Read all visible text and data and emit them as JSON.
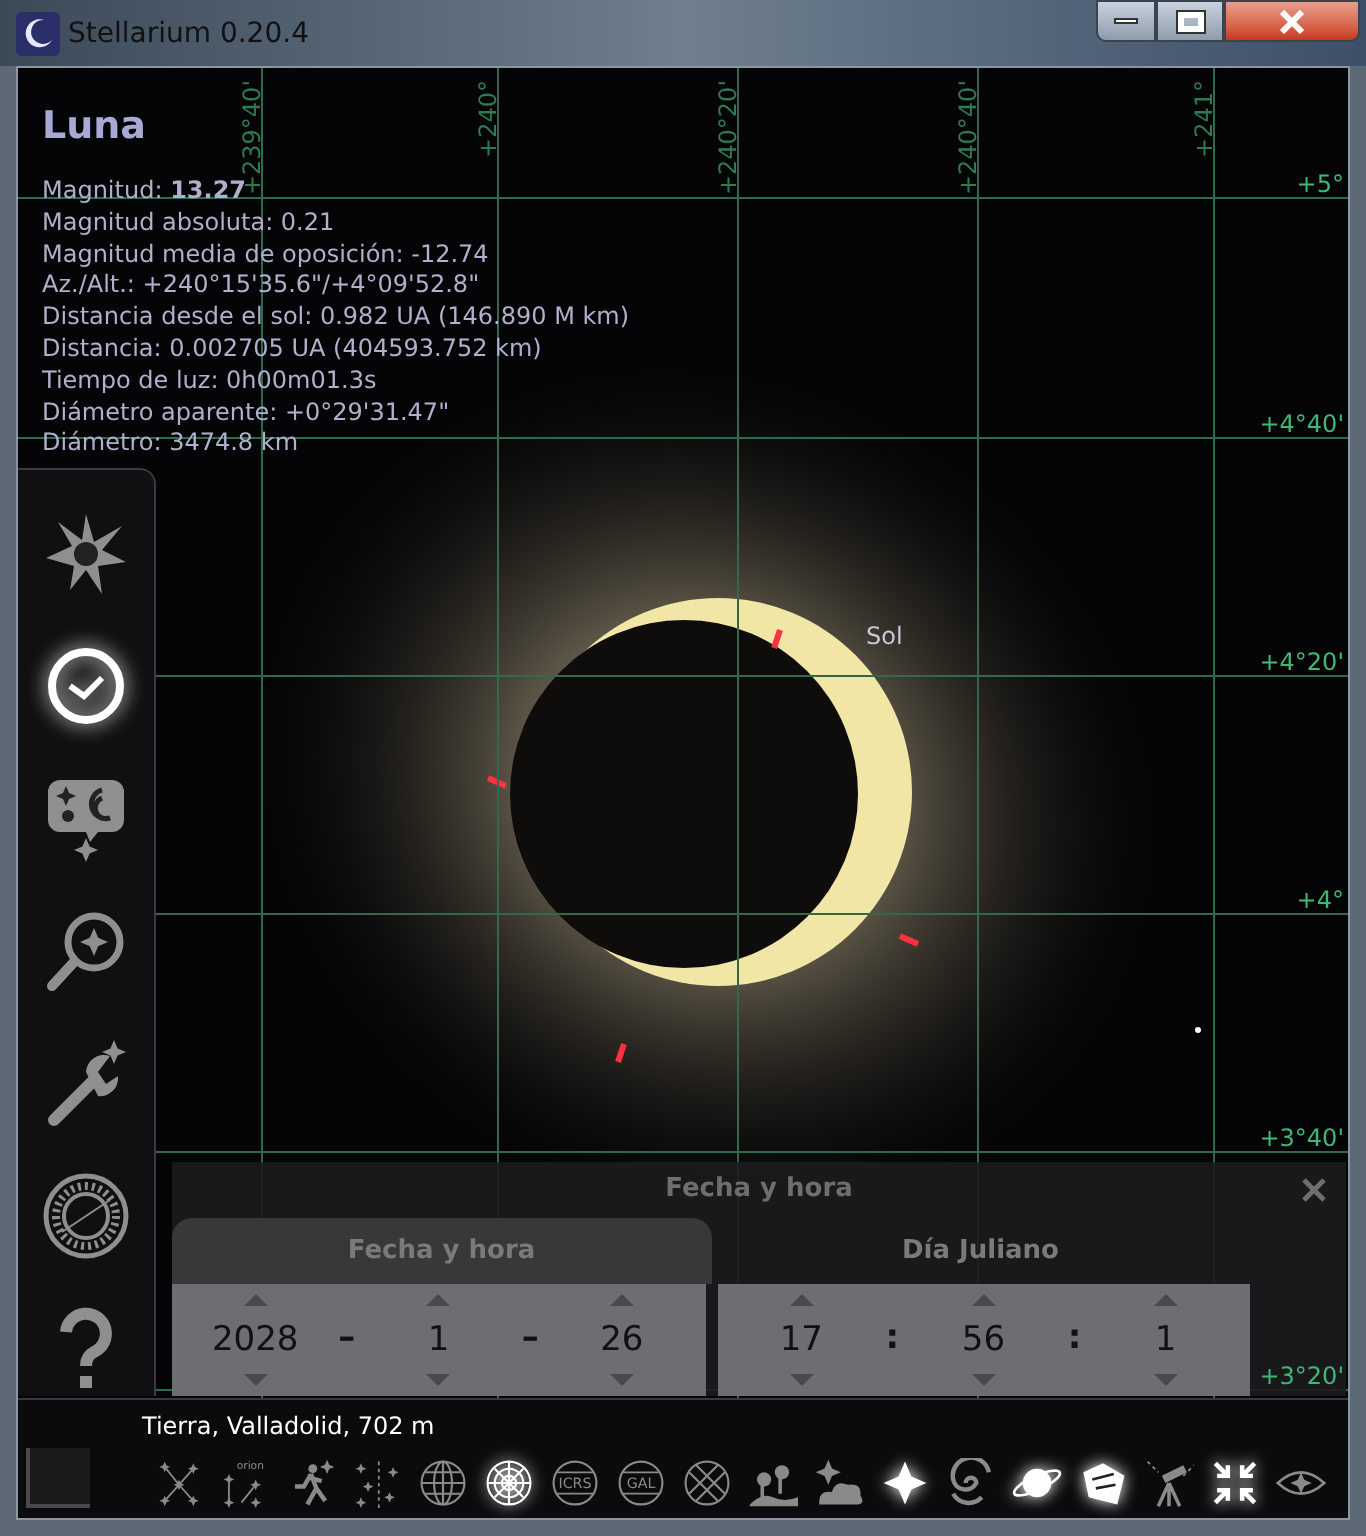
{
  "window": {
    "title": "Stellarium 0.20.4"
  },
  "object_info": {
    "name": "Luna",
    "lines": [
      "Magnitud: **13.27**",
      "Magnitud absoluta: 0.21",
      "Magnitud media de oposición: -12.74",
      "Az./Alt.: +240°15'35.6\"/+4°09'52.8\"",
      "Distancia desde el sol: 0.982 UA (146.890 M km)",
      "Distancia: 0.002705 UA (404593.752 km)",
      "Tiempo de luz: 0h00m01.3s",
      "Diámetro aparente: +0°29'31.47\"",
      "Diámetro: 3474.8 km"
    ]
  },
  "grid_labels": {
    "top": [
      "+239°40'",
      "+240°",
      "+240°20'",
      "+240°40'",
      "+241°"
    ],
    "right": [
      "+5°",
      "+4°40'",
      "+4°20'",
      "+4°",
      "+3°40'",
      "+3°20'"
    ]
  },
  "sky": {
    "sun_label": "Sol"
  },
  "sidebar": {
    "items": [
      {
        "kind": "location",
        "selected": false
      },
      {
        "kind": "time",
        "selected": true
      },
      {
        "kind": "sky",
        "selected": false
      },
      {
        "kind": "search",
        "selected": false
      },
      {
        "kind": "config",
        "selected": false
      },
      {
        "kind": "view",
        "selected": false
      },
      {
        "kind": "help",
        "selected": false
      }
    ]
  },
  "date_dialog": {
    "title": "Fecha y hora",
    "tabs": [
      {
        "label": "Fecha y hora",
        "selected": true
      },
      {
        "label": "Día Juliano",
        "selected": false
      }
    ],
    "groups": [
      [
        {
          "kind": "spin",
          "text": "2028"
        },
        {
          "kind": "sep",
          "text": "–"
        },
        {
          "kind": "spin",
          "text": "1"
        },
        {
          "kind": "sep",
          "text": "–"
        },
        {
          "kind": "spin",
          "text": "26"
        }
      ],
      [
        {
          "kind": "spin",
          "text": "17"
        },
        {
          "kind": "sep",
          "text": ":"
        },
        {
          "kind": "spin",
          "text": "56"
        },
        {
          "kind": "sep",
          "text": ":"
        },
        {
          "kind": "spin",
          "text": "1"
        }
      ]
    ]
  },
  "status": {
    "location": "Tierra, Valladolid, 702 m"
  },
  "toolbar": [
    {
      "kind": "const-lines",
      "selected": false
    },
    {
      "kind": "const-labels",
      "label": "orion",
      "selected": false
    },
    {
      "kind": "const-art",
      "selected": false
    },
    {
      "kind": "const-bounds",
      "selected": false
    },
    {
      "kind": "eq-grid",
      "selected": false
    },
    {
      "kind": "az-grid",
      "selected": true
    },
    {
      "kind": "text-globe",
      "label": "ICRS",
      "selected": false
    },
    {
      "kind": "text-globe",
      "label": "GAL",
      "selected": false
    },
    {
      "kind": "ecl-grid",
      "selected": false
    },
    {
      "kind": "ground",
      "selected": false
    },
    {
      "kind": "atmosphere",
      "selected": false
    },
    {
      "kind": "stars",
      "selected": true
    },
    {
      "kind": "nebulae",
      "selected": false
    },
    {
      "kind": "planets",
      "selected": true
    },
    {
      "kind": "survey",
      "selected": true
    },
    {
      "kind": "telescope",
      "selected": false
    },
    {
      "kind": "fullscreen",
      "selected": true
    },
    {
      "kind": "night",
      "selected": false
    }
  ]
}
